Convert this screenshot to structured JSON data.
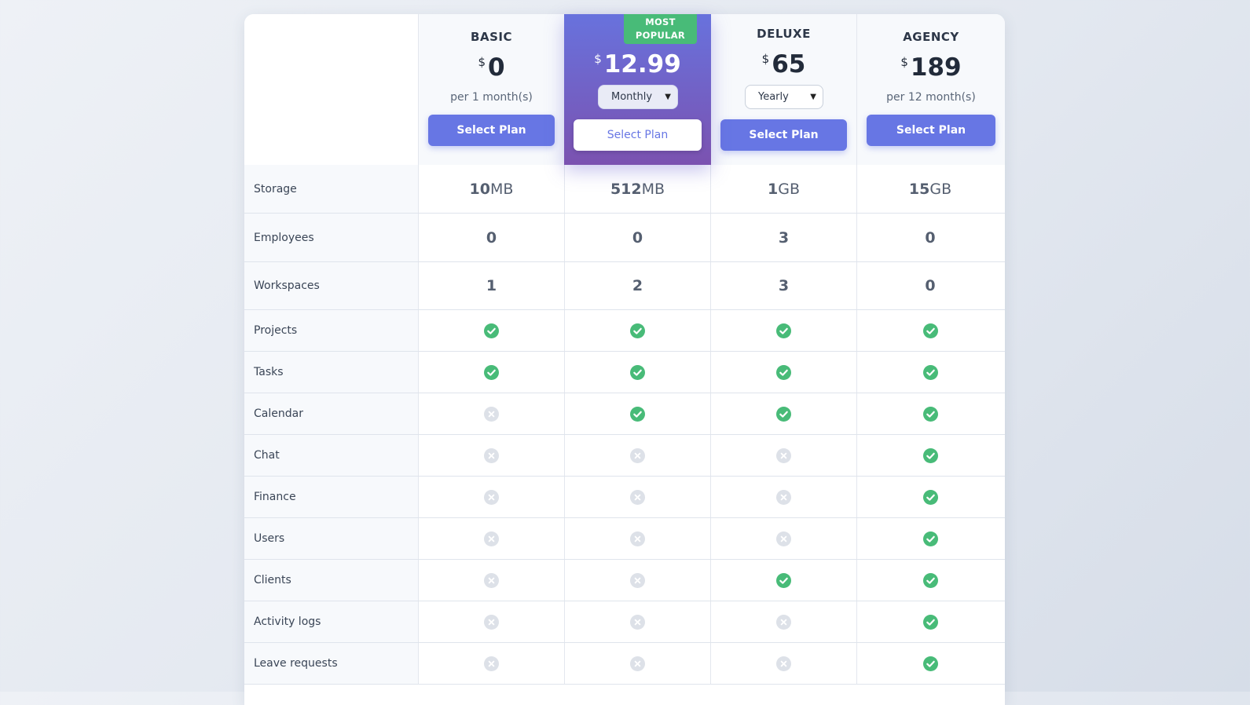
{
  "plans": [
    {
      "name": "BASIC",
      "currency": "$",
      "price": "0",
      "period": "per 1 month(s)",
      "button": "Select Plan",
      "popular": false
    },
    {
      "name": "",
      "currency": "$",
      "price": "12.99",
      "select": "Monthly",
      "badge_line1": "MOST",
      "badge_line2": "POPULAR",
      "button": "Select Plan",
      "popular": true
    },
    {
      "name": "DELUXE",
      "currency": "$",
      "price": "65",
      "select": "Yearly",
      "button": "Select Plan",
      "popular": false
    },
    {
      "name": "AGENCY",
      "currency": "$",
      "price": "189",
      "period": "per 12 month(s)",
      "button": "Select Plan",
      "popular": false
    }
  ],
  "features": {
    "storage": {
      "label": "Storage",
      "values": [
        {
          "num": "10",
          "unit": "MB"
        },
        {
          "num": "512",
          "unit": "MB"
        },
        {
          "num": "1",
          "unit": "GB"
        },
        {
          "num": "15",
          "unit": "GB"
        }
      ]
    },
    "employees": {
      "label": "Employees",
      "values": [
        "0",
        "0",
        "3",
        "0"
      ]
    },
    "workspaces": {
      "label": "Workspaces",
      "values": [
        "1",
        "2",
        "3",
        "0"
      ]
    },
    "checks": [
      {
        "label": "Projects",
        "values": [
          true,
          true,
          true,
          true
        ]
      },
      {
        "label": "Tasks",
        "values": [
          true,
          true,
          true,
          true
        ]
      },
      {
        "label": "Calendar",
        "values": [
          false,
          true,
          true,
          true
        ]
      },
      {
        "label": "Chat",
        "values": [
          false,
          false,
          false,
          true
        ]
      },
      {
        "label": "Finance",
        "values": [
          false,
          false,
          false,
          true
        ]
      },
      {
        "label": "Users",
        "values": [
          false,
          false,
          false,
          true
        ]
      },
      {
        "label": "Clients",
        "values": [
          false,
          false,
          true,
          true
        ]
      },
      {
        "label": "Activity logs",
        "values": [
          false,
          false,
          false,
          true
        ]
      },
      {
        "label": "Leave requests",
        "values": [
          false,
          false,
          false,
          true
        ]
      }
    ]
  },
  "colors": {
    "accent": "#6776e4",
    "check": "#48bb78",
    "cross": "#dde1e8",
    "popular_top": "#6872dd",
    "popular_bottom": "#7b52b0"
  }
}
